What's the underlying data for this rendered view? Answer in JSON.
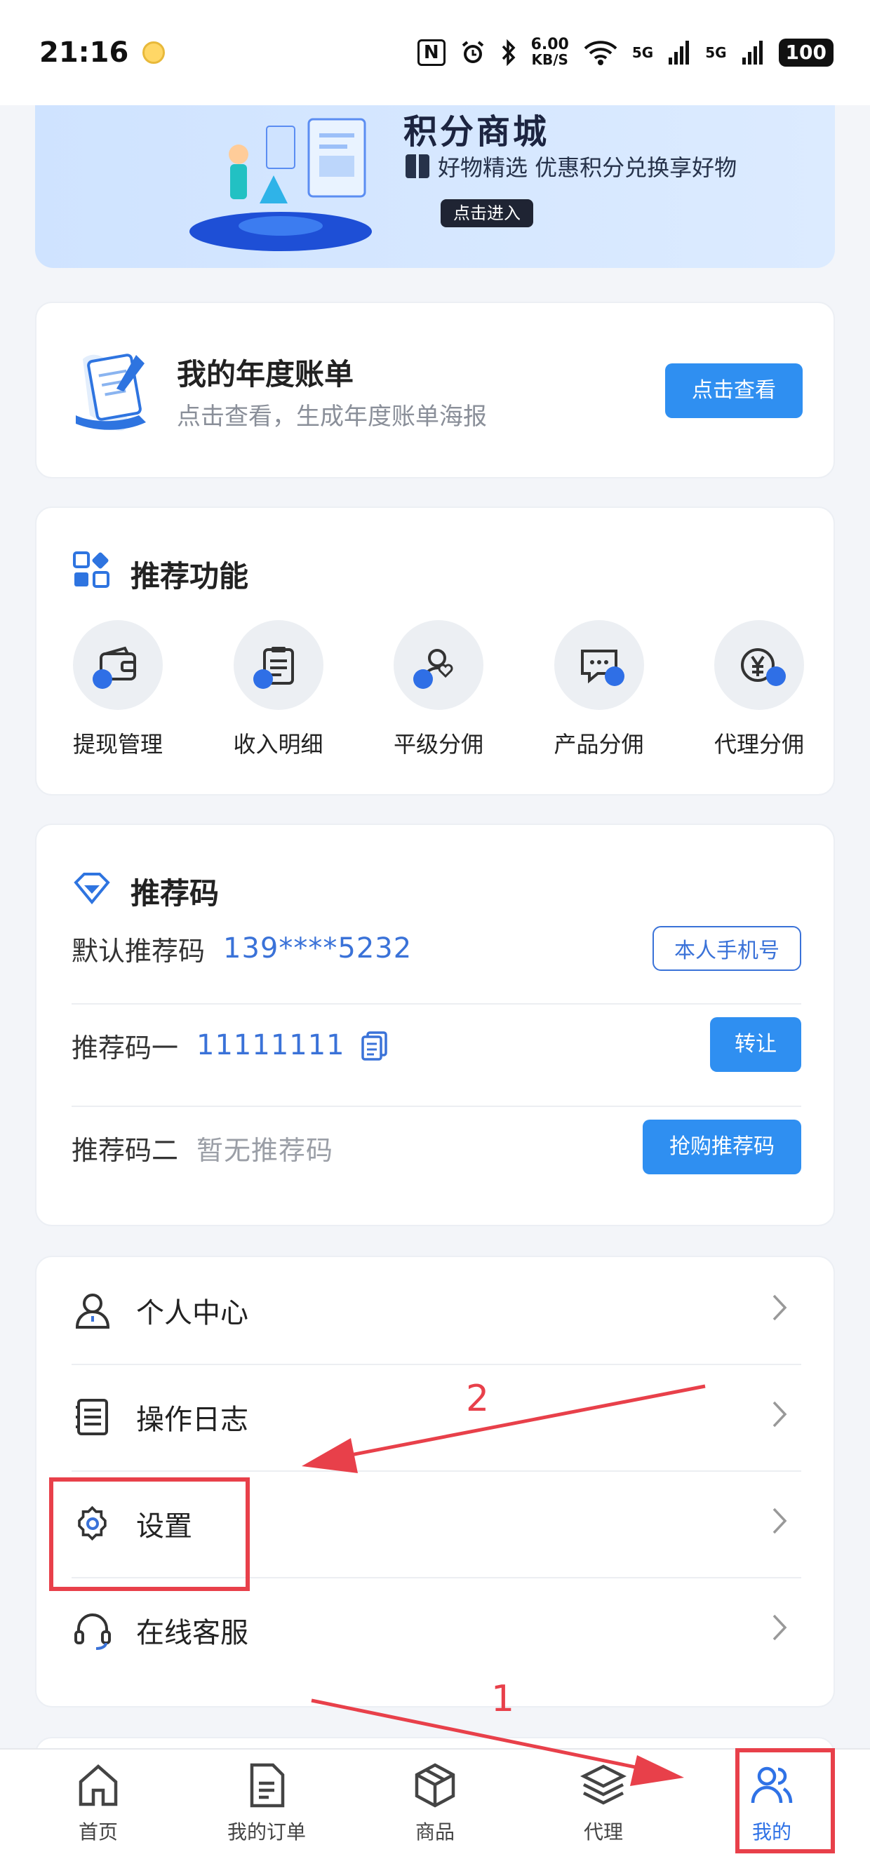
{
  "status_bar": {
    "time": "21:16",
    "nfc": "N",
    "net_speed_value": "6.00",
    "net_speed_unit": "KB/S",
    "signal1": "5G",
    "signal2": "5G",
    "battery": "100"
  },
  "banner": {
    "title": "积分商城",
    "subtitle": "好物精选 优惠积分兑换享好物",
    "button": "点击进入"
  },
  "annual_bill": {
    "title": "我的年度账单",
    "subtitle": "点击查看，生成年度账单海报",
    "button": "点击查看"
  },
  "functions": {
    "title": "推荐功能",
    "items": [
      {
        "label": "提现管理",
        "icon": "wallet-icon"
      },
      {
        "label": "收入明细",
        "icon": "clipboard-icon"
      },
      {
        "label": "平级分佣",
        "icon": "user-heart-icon"
      },
      {
        "label": "产品分佣",
        "icon": "chat-icon"
      },
      {
        "label": "代理分佣",
        "icon": "yuan-icon"
      }
    ]
  },
  "referral": {
    "title": "推荐码",
    "default_label": "默认推荐码",
    "default_value": "139****5232",
    "default_button": "本人手机号",
    "code1_label": "推荐码一",
    "code1_value": "11111111",
    "code1_button": "转让",
    "code2_label": "推荐码二",
    "code2_value": "暂无推荐码",
    "code2_button": "抢购推荐码"
  },
  "menu": {
    "items": [
      {
        "label": "个人中心",
        "icon": "person-icon"
      },
      {
        "label": "操作日志",
        "icon": "log-icon"
      },
      {
        "label": "设置",
        "icon": "gear-icon"
      },
      {
        "label": "在线客服",
        "icon": "headset-icon"
      }
    ]
  },
  "tabbar": {
    "items": [
      {
        "label": "首页",
        "icon": "home-icon",
        "active": false
      },
      {
        "label": "我的订单",
        "icon": "order-icon",
        "active": false
      },
      {
        "label": "商品",
        "icon": "box-icon",
        "active": false
      },
      {
        "label": "代理",
        "icon": "layers-icon",
        "active": false
      },
      {
        "label": "我的",
        "icon": "users-icon",
        "active": true
      }
    ]
  },
  "annotations": {
    "step1": "1",
    "step2": "2",
    "color": "#e8404a"
  },
  "colors": {
    "accent": "#2f8ff1",
    "link": "#3a72d8",
    "banner_bg": "#dcebff"
  }
}
